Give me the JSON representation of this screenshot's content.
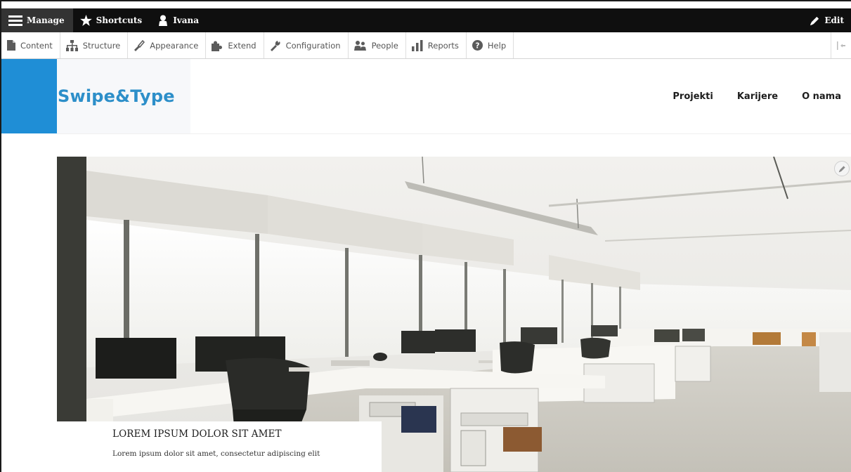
{
  "toolbar": {
    "manage_label": "Manage",
    "shortcuts_label": "Shortcuts",
    "user_label": "Ivana",
    "edit_label": "Edit"
  },
  "tray": {
    "items": [
      {
        "label": "Content",
        "icon": "file-icon"
      },
      {
        "label": "Structure",
        "icon": "sitemap-icon"
      },
      {
        "label": "Appearance",
        "icon": "paintbrush-icon"
      },
      {
        "label": "Extend",
        "icon": "puzzle-icon"
      },
      {
        "label": "Configuration",
        "icon": "wrench-icon"
      },
      {
        "label": "People",
        "icon": "people-icon"
      },
      {
        "label": "Reports",
        "icon": "bar-chart-icon"
      },
      {
        "label": "Help",
        "icon": "question-icon"
      }
    ]
  },
  "site": {
    "name": "Swipe&Type",
    "accent_color": "#1f8ed6"
  },
  "nav": {
    "items": [
      "Projekti",
      "Karijere",
      "O nama"
    ]
  },
  "hero": {
    "title": "LOREM IPSUM DOLOR SIT AMET",
    "text": "Lorem ipsum dolor sit amet, consectetur adipiscing elit"
  }
}
